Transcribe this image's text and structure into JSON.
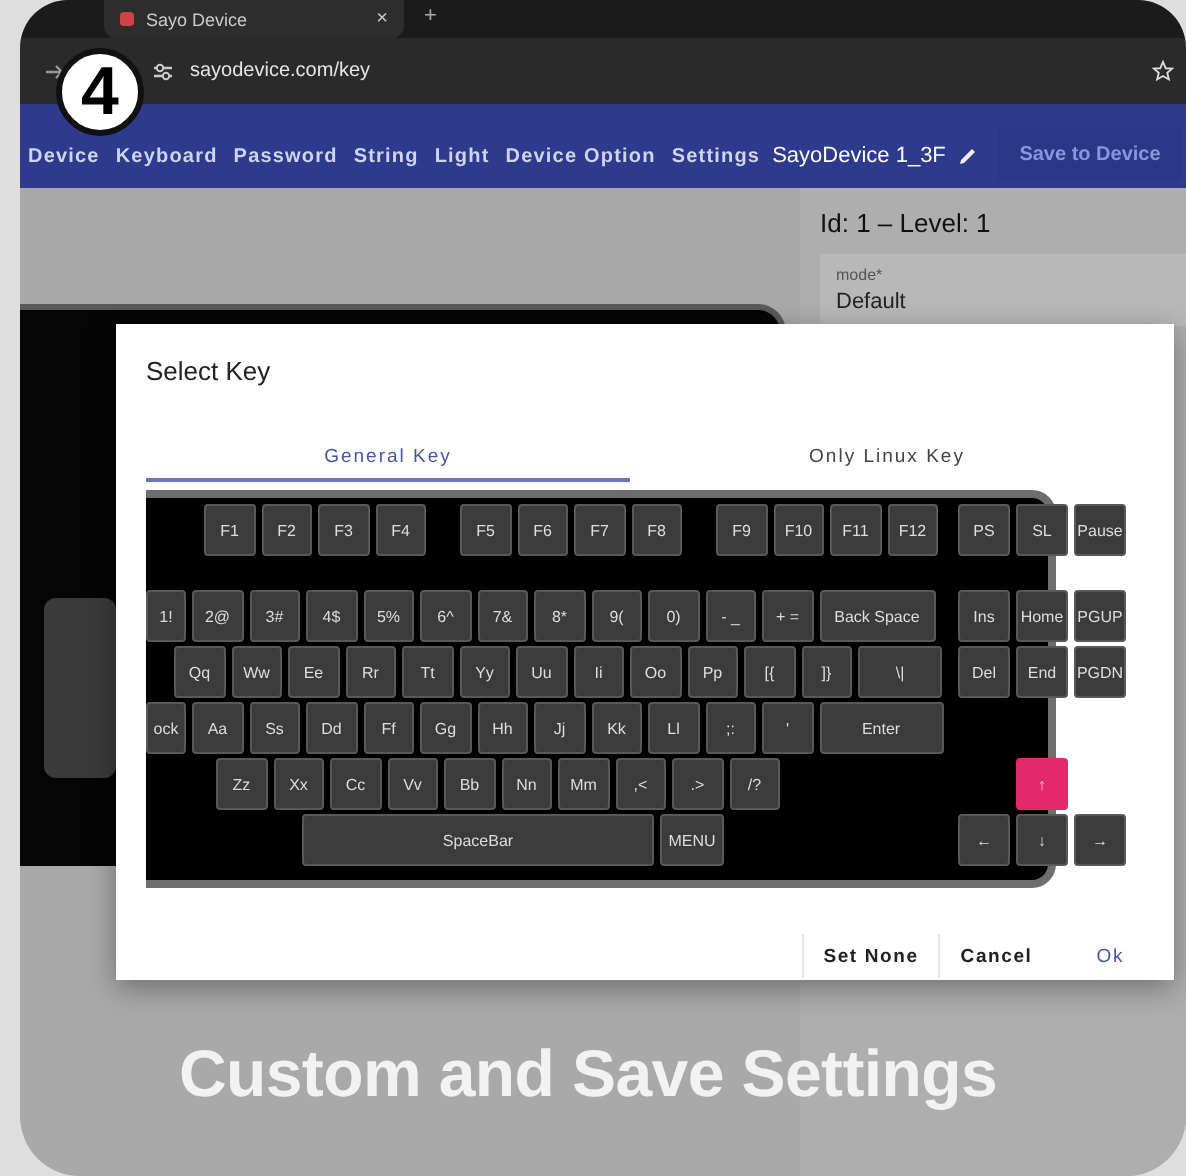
{
  "browser": {
    "tab": {
      "title": "Sayo Device",
      "close": "×"
    },
    "new_tab": "+",
    "url": "sayodevice.com/key"
  },
  "step_badge": "4",
  "nav": {
    "items": [
      "Device",
      "Keyboard",
      "Password",
      "String",
      "Light",
      "Device Option",
      "Settings"
    ],
    "device_name": "SayoDevice 1_3F",
    "save_button": "Save to Device"
  },
  "panel": {
    "heading": "Id:  1 – Level: 1",
    "field": {
      "label": "mode*",
      "value": "Default"
    }
  },
  "dialog": {
    "title": "Select Key",
    "tabs": [
      {
        "label": "General Key",
        "selected": true
      },
      {
        "label": "Only Linux Key",
        "selected": false
      }
    ],
    "keyboard": {
      "rows": [
        {
          "groups": [
            [
              {
                "label": "F1",
                "kind": "key",
                "selected": false
              },
              {
                "label": "F2",
                "kind": "key",
                "selected": false
              },
              {
                "label": "F3",
                "kind": "key",
                "selected": false
              },
              {
                "label": "F4",
                "kind": "key",
                "selected": false
              }
            ],
            [
              {
                "label": "F5",
                "kind": "key",
                "selected": false
              },
              {
                "label": "F6",
                "kind": "key",
                "selected": false
              },
              {
                "label": "F7",
                "kind": "key",
                "selected": false
              },
              {
                "label": "F8",
                "kind": "key",
                "selected": false
              }
            ],
            [
              {
                "label": "F9",
                "kind": "key",
                "selected": false
              },
              {
                "label": "F10",
                "kind": "key",
                "selected": false
              },
              {
                "label": "F11",
                "kind": "key",
                "selected": false
              },
              {
                "label": "F12",
                "kind": "key",
                "selected": false
              }
            ]
          ],
          "nav": [
            {
              "label": "PS",
              "selected": false
            },
            {
              "label": "SL",
              "selected": false
            },
            {
              "label": "Pause",
              "selected": false
            }
          ]
        },
        {
          "groups": [
            [
              {
                "label": "1!",
                "kind": "cut",
                "selected": false
              },
              {
                "label": "2@",
                "kind": "key",
                "selected": false
              },
              {
                "label": "3#",
                "kind": "key",
                "selected": false
              },
              {
                "label": "4$",
                "kind": "key",
                "selected": false
              },
              {
                "label": "5%",
                "kind": "key",
                "selected": false
              },
              {
                "label": "6^",
                "kind": "key",
                "selected": false
              },
              {
                "label": "7&",
                "kind": "key",
                "selected": false
              },
              {
                "label": "8*",
                "kind": "key",
                "selected": false
              },
              {
                "label": "9(",
                "kind": "key",
                "selected": false
              },
              {
                "label": "0)",
                "kind": "key",
                "selected": false
              },
              {
                "label": "- _",
                "kind": "key",
                "selected": false
              },
              {
                "label": "+ =",
                "kind": "key",
                "selected": false
              },
              {
                "label": "Back Space",
                "kind": "backspace",
                "selected": false
              }
            ]
          ],
          "nav": [
            {
              "label": "Ins",
              "selected": false
            },
            {
              "label": "Home",
              "selected": false
            },
            {
              "label": "PGUP",
              "selected": false
            }
          ]
        },
        {
          "groups": [
            [
              {
                "label": "Qq",
                "kind": "key",
                "selected": false
              },
              {
                "label": "Ww",
                "kind": "key",
                "selected": false
              },
              {
                "label": "Ee",
                "kind": "key",
                "selected": false
              },
              {
                "label": "Rr",
                "kind": "key",
                "selected": false
              },
              {
                "label": "Tt",
                "kind": "key",
                "selected": false
              },
              {
                "label": "Yy",
                "kind": "key",
                "selected": false
              },
              {
                "label": "Uu",
                "kind": "key",
                "selected": false
              },
              {
                "label": "Ii",
                "kind": "key",
                "selected": false
              },
              {
                "label": "Oo",
                "kind": "key",
                "selected": false
              },
              {
                "label": "Pp",
                "kind": "key",
                "selected": false
              },
              {
                "label": "[{",
                "kind": "key",
                "selected": false
              },
              {
                "label": "]}",
                "kind": "key",
                "selected": false
              },
              {
                "label": "\\|",
                "kind": "backslash",
                "selected": false
              }
            ]
          ],
          "nav": [
            {
              "label": "Del",
              "selected": false
            },
            {
              "label": "End",
              "selected": false
            },
            {
              "label": "PGDN",
              "selected": false
            }
          ]
        },
        {
          "groups": [
            [
              {
                "label": "ock",
                "kind": "cut",
                "selected": false
              },
              {
                "label": "Aa",
                "kind": "key",
                "selected": false
              },
              {
                "label": "Ss",
                "kind": "key",
                "selected": false
              },
              {
                "label": "Dd",
                "kind": "key",
                "selected": false
              },
              {
                "label": "Ff",
                "kind": "key",
                "selected": false
              },
              {
                "label": "Gg",
                "kind": "key",
                "selected": false
              },
              {
                "label": "Hh",
                "kind": "key",
                "selected": false
              },
              {
                "label": "Jj",
                "kind": "key",
                "selected": false
              },
              {
                "label": "Kk",
                "kind": "key",
                "selected": false
              },
              {
                "label": "Ll",
                "kind": "key",
                "selected": false
              },
              {
                "label": ";:",
                "kind": "key",
                "selected": false
              },
              {
                "label": "'",
                "kind": "key",
                "selected": false
              },
              {
                "label": "Enter",
                "kind": "enter",
                "selected": false
              }
            ]
          ],
          "nav": []
        },
        {
          "groups": [
            [
              {
                "label": "Zz",
                "kind": "key",
                "selected": false
              },
              {
                "label": "Xx",
                "kind": "key",
                "selected": false
              },
              {
                "label": "Cc",
                "kind": "key",
                "selected": false
              },
              {
                "label": "Vv",
                "kind": "key",
                "selected": false
              },
              {
                "label": "Bb",
                "kind": "key",
                "selected": false
              },
              {
                "label": "Nn",
                "kind": "key",
                "selected": false
              },
              {
                "label": "Mm",
                "kind": "key",
                "selected": false
              },
              {
                "label": ",<",
                "kind": "key",
                "selected": false
              },
              {
                "label": ".>",
                "kind": "key",
                "selected": false
              },
              {
                "label": "/?",
                "kind": "key",
                "selected": false
              }
            ]
          ],
          "nav": [
            {
              "label": "↑",
              "selected": true
            }
          ]
        },
        {
          "groups": [
            [
              {
                "label": "SpaceBar",
                "kind": "spacebar",
                "selected": false
              },
              {
                "label": "MENU",
                "kind": "menu",
                "selected": false
              }
            ]
          ],
          "nav": [
            {
              "label": "←",
              "selected": false
            },
            {
              "label": "↓",
              "selected": false
            },
            {
              "label": "→",
              "selected": false
            }
          ]
        }
      ]
    },
    "actions": [
      {
        "label": "Set None",
        "kind": "text"
      },
      {
        "label": "Cancel",
        "kind": "text"
      },
      {
        "label": "Ok",
        "kind": "primary"
      }
    ]
  },
  "caption": "Custom and Save Settings"
}
